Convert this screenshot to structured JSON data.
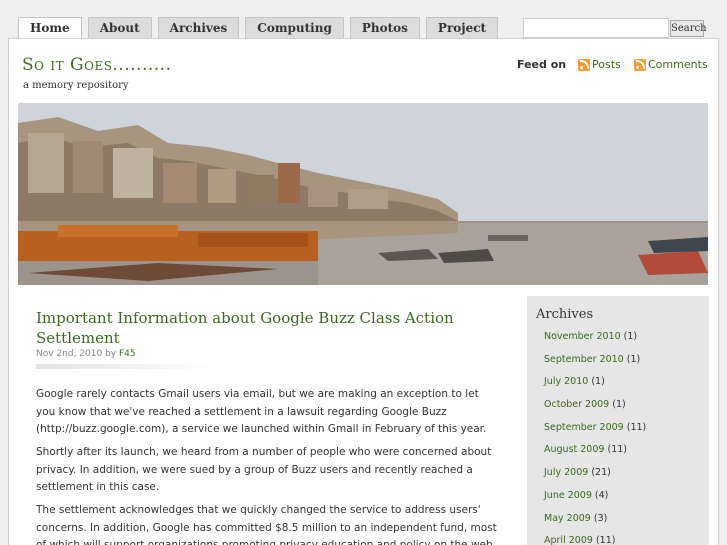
{
  "nav": {
    "tabs": [
      {
        "label": "Home",
        "active": true
      },
      {
        "label": "About",
        "active": false
      },
      {
        "label": "Archives",
        "active": false
      },
      {
        "label": "Computing",
        "active": false
      },
      {
        "label": "Photos",
        "active": false
      },
      {
        "label": "Project",
        "active": false
      }
    ],
    "search_value": "",
    "search_button": "Search"
  },
  "header": {
    "blog_title": "So it Goes..........",
    "tagline": "a memory repository",
    "feed_label": "Feed on",
    "feed_posts": "Posts",
    "feed_comments": "Comments"
  },
  "post": {
    "title": "Important Information about Google Buzz Class Action Settlement",
    "date": "Nov 2nd, 2010",
    "by": "by",
    "author": "F45",
    "paragraphs": [
      "Google rarely contacts Gmail users via email, but we are making an exception to let you know that we've reached a settlement in a lawsuit regarding Google Buzz (http://buzz.google.com), a service we launched within Gmail in February of this year.",
      "Shortly after its launch, we heard from a number of people who were concerned about privacy. In addition, we were sued by a group of Buzz users and recently reached a settlement in this case.",
      "The settlement acknowledges that we quickly changed the service to address users' concerns. In addition, Google has committed $8.5 million to an independent fund, most of which will support organizations promoting privacy education and policy on the web."
    ]
  },
  "sidebar": {
    "title": "Archives",
    "items": [
      {
        "label": "November 2010",
        "count": "(1)"
      },
      {
        "label": "September 2010",
        "count": "(1)"
      },
      {
        "label": "July 2010",
        "count": "(1)"
      },
      {
        "label": "October 2009",
        "count": "(1)"
      },
      {
        "label": "September 2009",
        "count": "(11)"
      },
      {
        "label": "August 2009",
        "count": "(11)"
      },
      {
        "label": "July 2009",
        "count": "(21)"
      },
      {
        "label": "June 2009",
        "count": "(4)"
      },
      {
        "label": "May 2009",
        "count": "(3)"
      },
      {
        "label": "April 2009",
        "count": "(11)"
      }
    ]
  },
  "colors": {
    "accent_green": "#3a6b1e",
    "rss_orange": "#f79a2f"
  }
}
